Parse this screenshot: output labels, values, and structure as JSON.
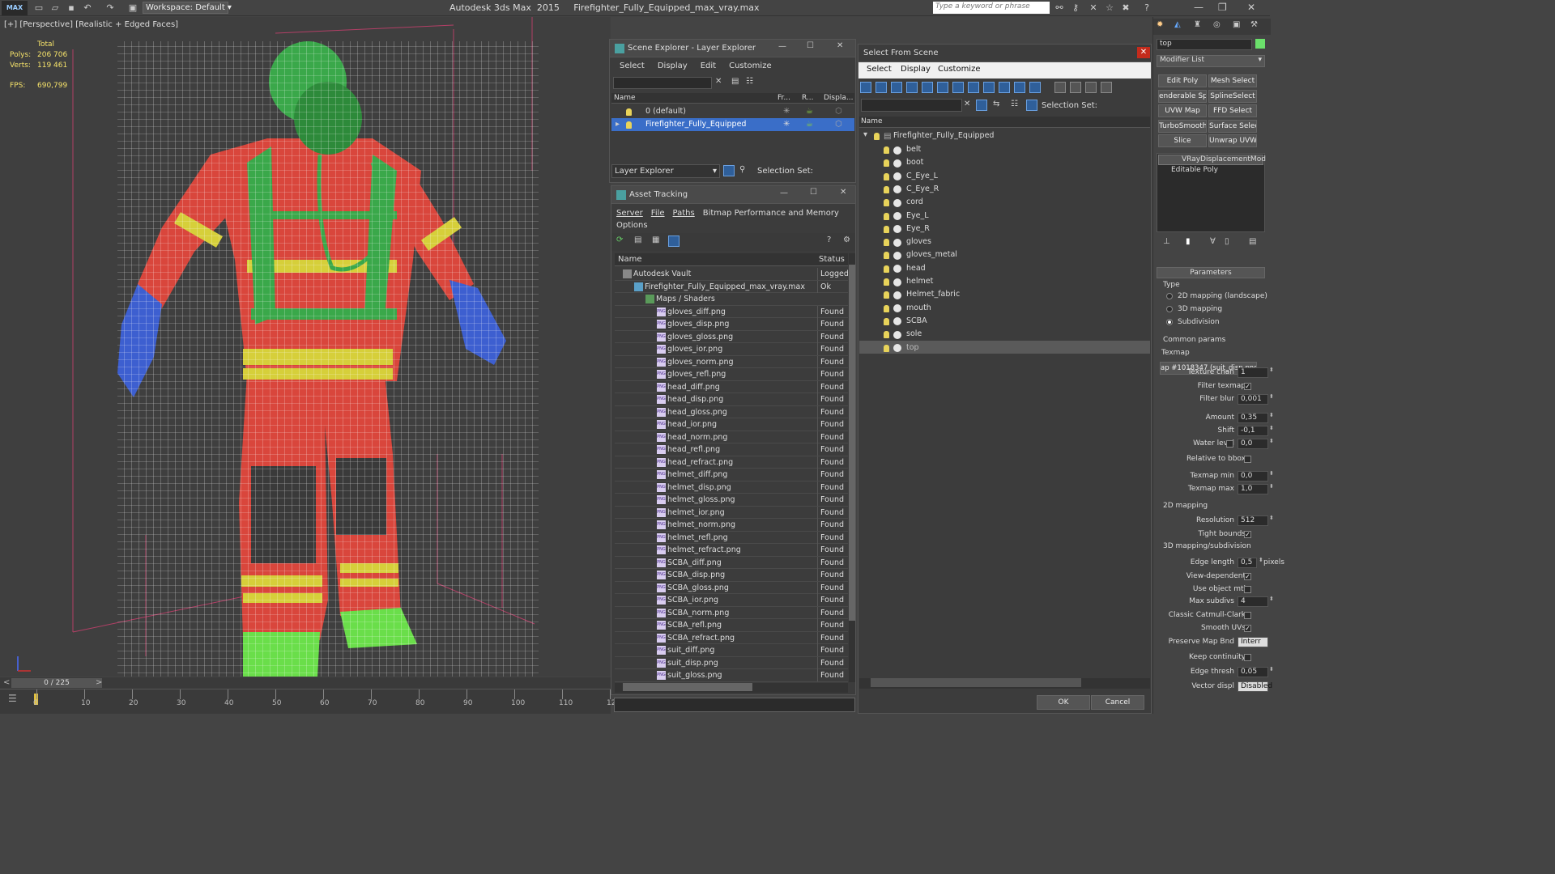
{
  "titlebar": {
    "workspace": "Workspace: Default",
    "title": "Autodesk 3ds Max  2015     Firefighter_Fully_Equipped_max_vray.max",
    "search_placeholder": "Type a keyword or phrase",
    "logo": "MAX"
  },
  "viewport": {
    "label": "[+] [Perspective] [Realistic + Edged Faces]",
    "stats": {
      "total_label": "Total",
      "polys_label": "Polys:",
      "polys": "206 706",
      "verts_label": "Verts:",
      "verts": "119 461",
      "fps_label": "FPS:",
      "fps": "690,799"
    }
  },
  "timeline": {
    "frame": "0 / 225",
    "ticks": [
      "0",
      "10",
      "20",
      "30",
      "40",
      "50",
      "60",
      "70",
      "80",
      "90",
      "100",
      "110",
      "12"
    ]
  },
  "scene_explorer": {
    "title": "Scene Explorer - Layer Explorer",
    "menu": [
      "Select",
      "Display",
      "Edit",
      "Customize"
    ],
    "columns": [
      "Name",
      "Fr...",
      "R...",
      "Displa..."
    ],
    "rows": [
      "0 (default)",
      "Firefighter_Fully_Equipped"
    ],
    "footer_dropdown": "Layer Explorer",
    "selection_set": "Selection Set:"
  },
  "asset_tracking": {
    "title": "Asset Tracking",
    "menu": [
      "Server",
      "File",
      "Paths",
      "Bitmap Performance and Memory",
      "Options"
    ],
    "columns": [
      "Name",
      "Status"
    ],
    "rows": [
      {
        "name": "Autodesk Vault",
        "status": "Logged",
        "indent": 1,
        "kind": "vault"
      },
      {
        "name": "Firefighter_Fully_Equipped_max_vray.max",
        "status": "Ok",
        "indent": 2,
        "kind": "max"
      },
      {
        "name": "Maps / Shaders",
        "status": "",
        "indent": 3,
        "kind": "folder"
      },
      {
        "name": "gloves_diff.png",
        "status": "Found",
        "indent": 4,
        "kind": "png"
      },
      {
        "name": "gloves_disp.png",
        "status": "Found",
        "indent": 4,
        "kind": "png"
      },
      {
        "name": "gloves_gloss.png",
        "status": "Found",
        "indent": 4,
        "kind": "png"
      },
      {
        "name": "gloves_ior.png",
        "status": "Found",
        "indent": 4,
        "kind": "png"
      },
      {
        "name": "gloves_norm.png",
        "status": "Found",
        "indent": 4,
        "kind": "png"
      },
      {
        "name": "gloves_refl.png",
        "status": "Found",
        "indent": 4,
        "kind": "png"
      },
      {
        "name": "head_diff.png",
        "status": "Found",
        "indent": 4,
        "kind": "png"
      },
      {
        "name": "head_disp.png",
        "status": "Found",
        "indent": 4,
        "kind": "png"
      },
      {
        "name": "head_gloss.png",
        "status": "Found",
        "indent": 4,
        "kind": "png"
      },
      {
        "name": "head_ior.png",
        "status": "Found",
        "indent": 4,
        "kind": "png"
      },
      {
        "name": "head_norm.png",
        "status": "Found",
        "indent": 4,
        "kind": "png"
      },
      {
        "name": "head_refl.png",
        "status": "Found",
        "indent": 4,
        "kind": "png"
      },
      {
        "name": "head_refract.png",
        "status": "Found",
        "indent": 4,
        "kind": "png"
      },
      {
        "name": "helmet_diff.png",
        "status": "Found",
        "indent": 4,
        "kind": "png"
      },
      {
        "name": "helmet_disp.png",
        "status": "Found",
        "indent": 4,
        "kind": "png"
      },
      {
        "name": "helmet_gloss.png",
        "status": "Found",
        "indent": 4,
        "kind": "png"
      },
      {
        "name": "helmet_ior.png",
        "status": "Found",
        "indent": 4,
        "kind": "png"
      },
      {
        "name": "helmet_norm.png",
        "status": "Found",
        "indent": 4,
        "kind": "png"
      },
      {
        "name": "helmet_refl.png",
        "status": "Found",
        "indent": 4,
        "kind": "png"
      },
      {
        "name": "helmet_refract.png",
        "status": "Found",
        "indent": 4,
        "kind": "png"
      },
      {
        "name": "SCBA_diff.png",
        "status": "Found",
        "indent": 4,
        "kind": "png"
      },
      {
        "name": "SCBA_disp.png",
        "status": "Found",
        "indent": 4,
        "kind": "png"
      },
      {
        "name": "SCBA_gloss.png",
        "status": "Found",
        "indent": 4,
        "kind": "png"
      },
      {
        "name": "SCBA_ior.png",
        "status": "Found",
        "indent": 4,
        "kind": "png"
      },
      {
        "name": "SCBA_norm.png",
        "status": "Found",
        "indent": 4,
        "kind": "png"
      },
      {
        "name": "SCBA_refl.png",
        "status": "Found",
        "indent": 4,
        "kind": "png"
      },
      {
        "name": "SCBA_refract.png",
        "status": "Found",
        "indent": 4,
        "kind": "png"
      },
      {
        "name": "suit_diff.png",
        "status": "Found",
        "indent": 4,
        "kind": "png"
      },
      {
        "name": "suit_disp.png",
        "status": "Found",
        "indent": 4,
        "kind": "png"
      },
      {
        "name": "suit_gloss.png",
        "status": "Found",
        "indent": 4,
        "kind": "png"
      }
    ]
  },
  "select_from_scene": {
    "title": "Select From Scene",
    "menu": [
      "Select",
      "Display",
      "Customize"
    ],
    "selection_set": "Selection Set:",
    "column": "Name",
    "root": "Firefighter_Fully_Equipped",
    "items": [
      "belt",
      "boot",
      "C_Eye_L",
      "C_Eye_R",
      "cord",
      "Eye_L",
      "Eye_R",
      "gloves",
      "gloves_metal",
      "head",
      "helmet",
      "Helmet_fabric",
      "mouth",
      "SCBA",
      "sole",
      "top"
    ],
    "selected": "top",
    "ok": "OK",
    "cancel": "Cancel"
  },
  "command_panel": {
    "object_name": "top",
    "modifier_list": "Modifier List",
    "buttons": [
      "Edit Poly",
      "Mesh Select",
      "enderable Spli",
      "SplineSelect",
      "UVW Map",
      "FFD Select",
      "TurboSmooth",
      "Surface Select",
      "Slice",
      "Unwrap UVW"
    ],
    "stack": [
      "VRayDisplacementMod",
      "Editable Poly"
    ],
    "params": {
      "rollout": "Parameters",
      "type_label": "Type",
      "type_options": [
        "2D mapping (landscape)",
        "3D mapping",
        "Subdivision"
      ],
      "type_selected": 2,
      "common": "Common params",
      "texmap_label": "Texmap",
      "texmap": "ap #1018347 (suit_disp.png)",
      "texture_chan_label": "Texture chan",
      "texture_chan": "1",
      "filter_texmap": "Filter texmap",
      "filter_blur_label": "Filter blur",
      "filter_blur": "0,001",
      "amount_label": "Amount",
      "amount": "0,35",
      "shift_label": "Shift",
      "shift": "-0,1",
      "water_label": "Water level",
      "water": "0,0",
      "relative": "Relative to bbox",
      "texmap_min_label": "Texmap min",
      "texmap_min": "0,0",
      "texmap_max_label": "Texmap max",
      "texmap_max": "1,0",
      "map2d": "2D mapping",
      "resolution_label": "Resolution",
      "resolution": "512",
      "tight": "Tight bounds",
      "map3d": "3D mapping/subdivision",
      "edge_length_label": "Edge length",
      "edge_length": "0,5",
      "pixels": "pixels",
      "view_dep": "View-dependent",
      "use_obj": "Use object mtl",
      "max_subdivs_label": "Max subdivs",
      "max_subdivs": "4",
      "catmull": "Classic Catmull-Clark",
      "smooth_uv": "Smooth UVs",
      "preserve_label": "Preserve Map Bnd",
      "preserve": "Interr",
      "keep": "Keep continuity",
      "edge_thresh_label": "Edge thresh",
      "edge_thresh": "0,05",
      "vector_label": "Vector displ",
      "vector": "Disabled"
    }
  }
}
